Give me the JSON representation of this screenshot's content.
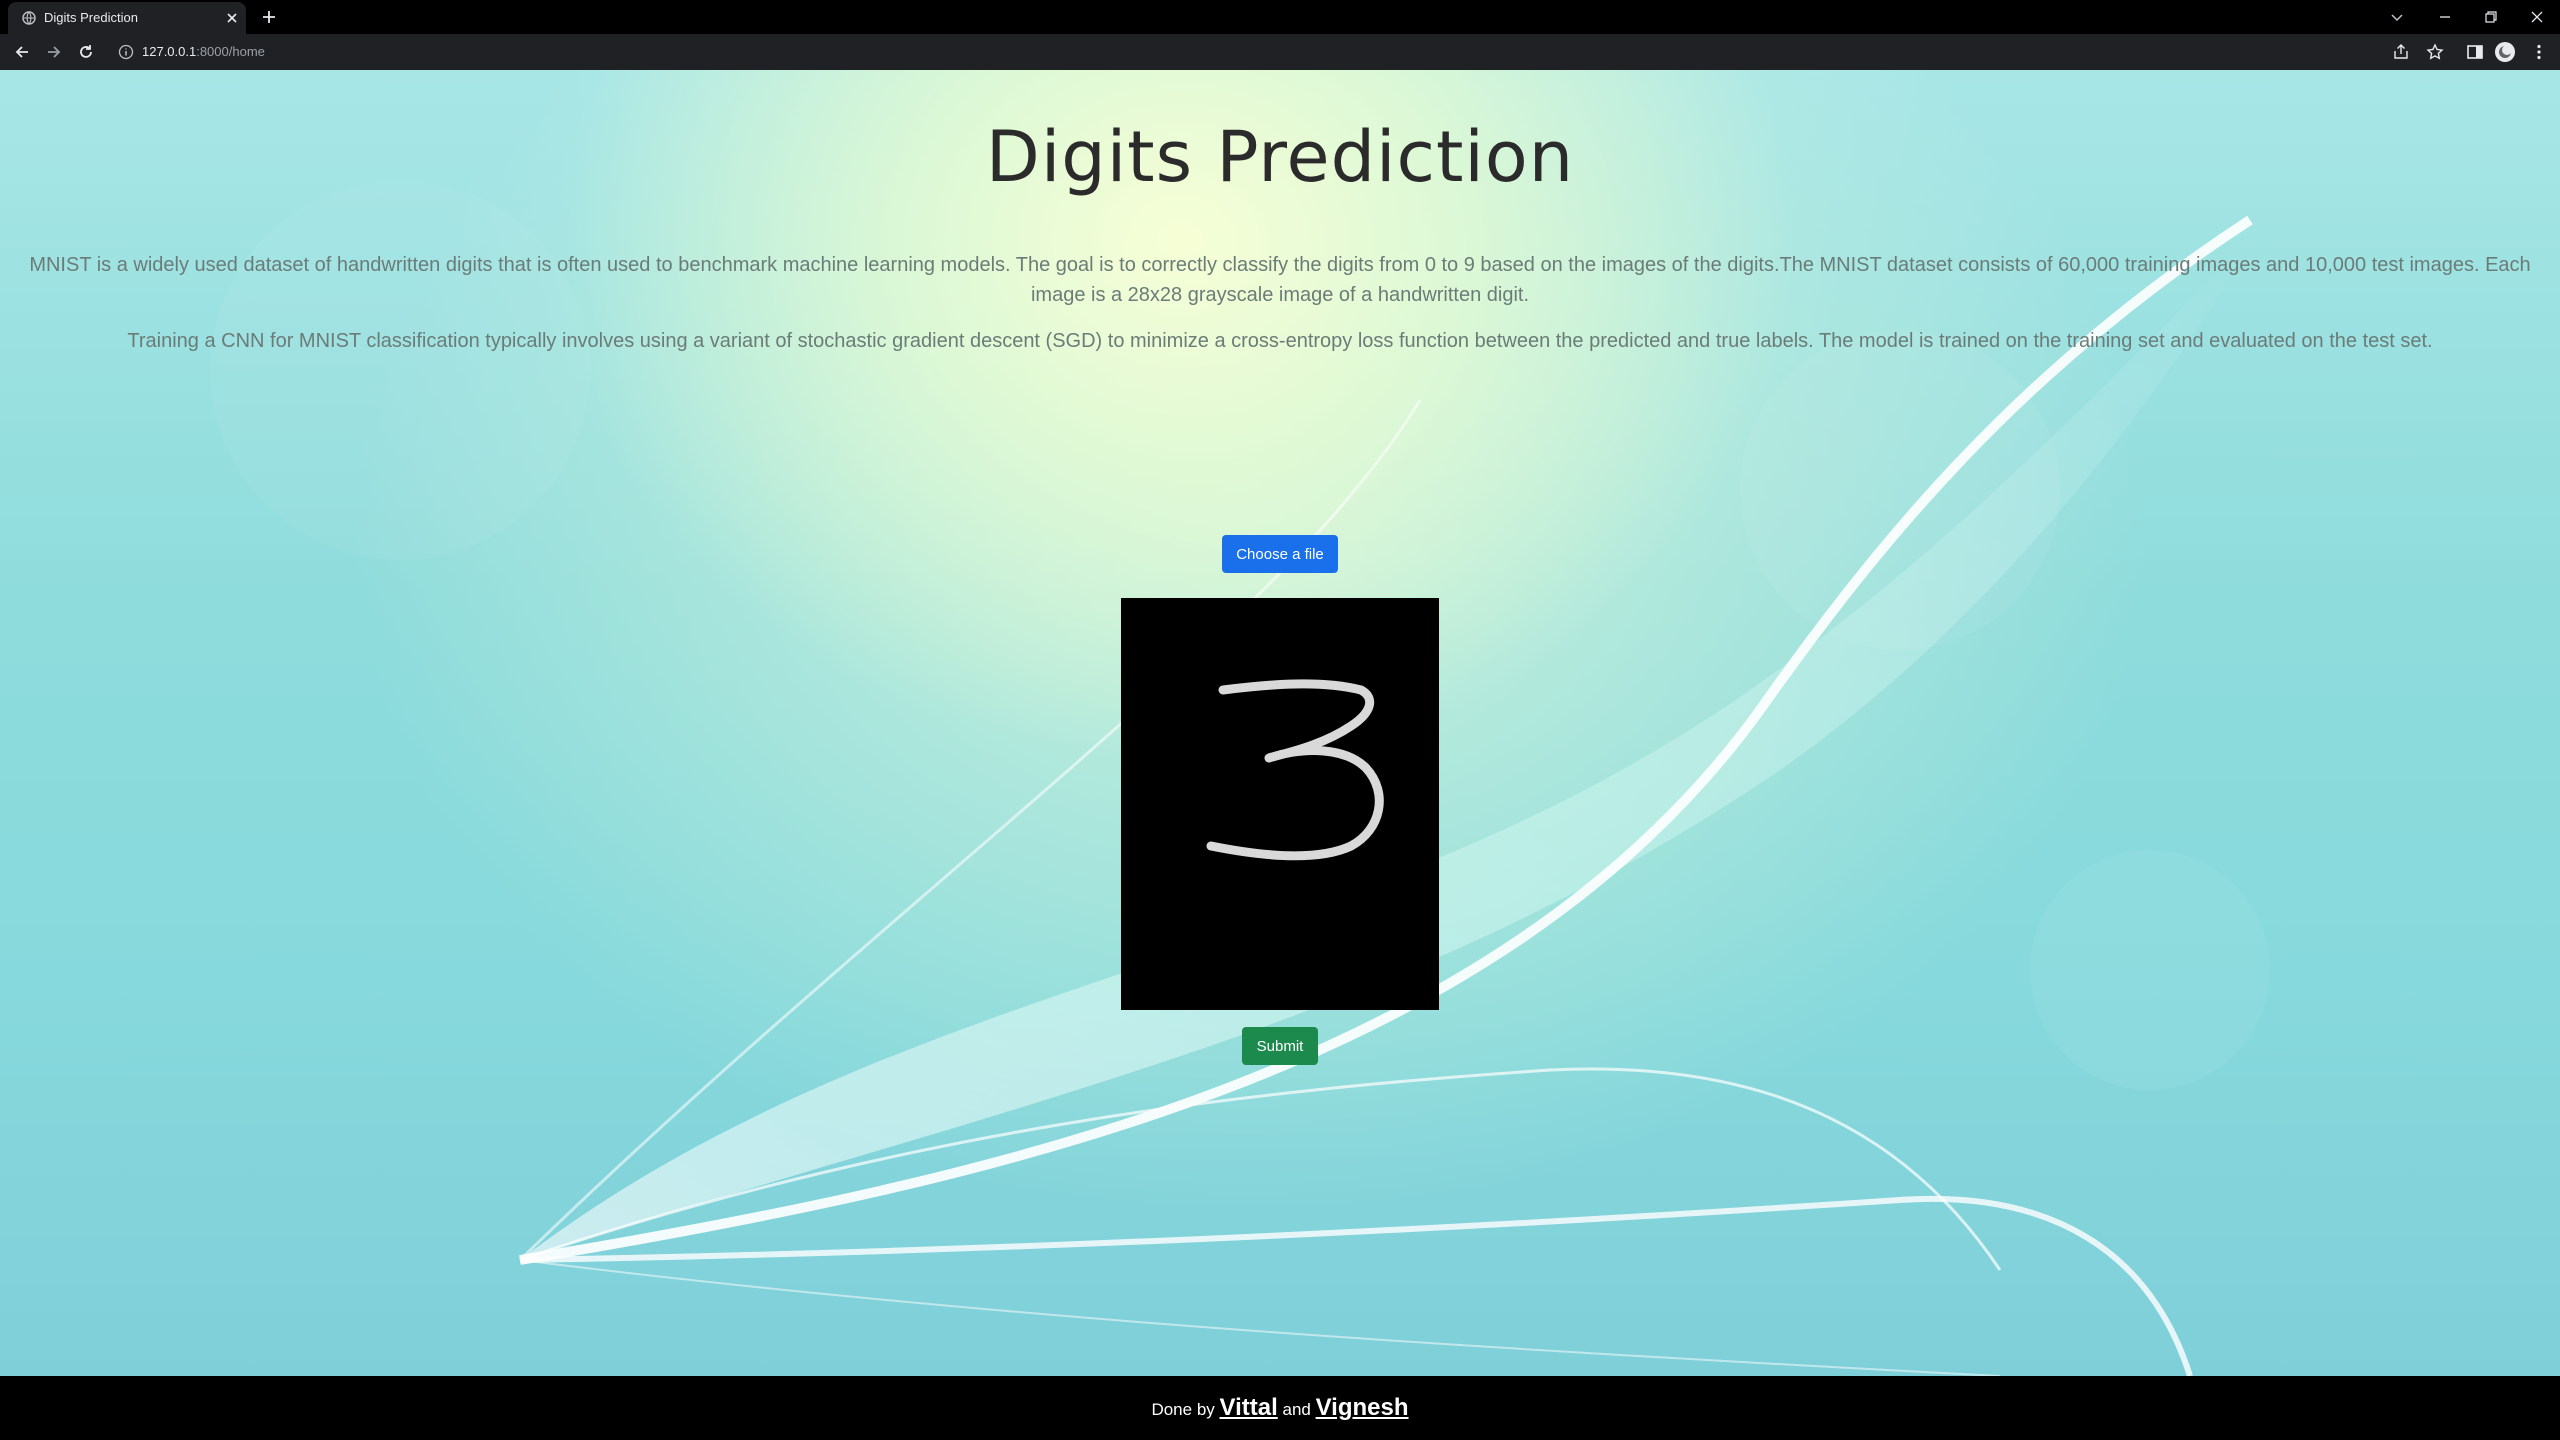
{
  "browser": {
    "tab_title": "Digits Prediction",
    "url_host": "127.0.0.1",
    "url_path": ":8000/home"
  },
  "page": {
    "title": "Digits Prediction",
    "description_1": "MNIST is a widely used dataset of handwritten digits that is often used to benchmark machine learning models. The goal is to correctly classify the digits from 0 to 9 based on the images of the digits.The MNIST dataset consists of 60,000 training images and 10,000 test images. Each image is a 28x28 grayscale image of a handwritten digit.",
    "description_2": "Training a CNN for MNIST classification typically involves using a variant of stochastic gradient descent (SGD) to minimize a cross-entropy loss function between the predicted and true labels. The model is trained on the training set and evaluated on the test set.",
    "choose_file_label": "Choose a file",
    "submit_label": "Submit"
  },
  "footer": {
    "prefix": "Done by",
    "author_1": "Vittal",
    "joiner": "and",
    "author_2": "Vignesh"
  },
  "colors": {
    "choose_button": "#1a6fea",
    "submit_button": "#1c8a4c",
    "chrome_bg": "#202124"
  },
  "icons": [
    "globe-icon",
    "close-icon",
    "plus-icon",
    "back-icon",
    "forward-icon",
    "reload-icon",
    "info-icon",
    "share-icon",
    "star-icon",
    "sidebar-icon",
    "profile-icon",
    "more-icon"
  ]
}
